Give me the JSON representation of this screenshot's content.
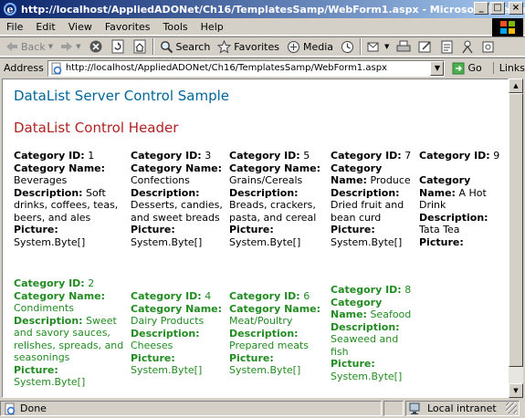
{
  "window": {
    "title": "http://localhost/AppliedADONet/Ch16/TemplatesSamp/WebForm1.aspx - Microsoft Internet Explorer",
    "minimize": "_",
    "maximize": "□",
    "close": "×"
  },
  "menu": [
    "File",
    "Edit",
    "View",
    "Favorites",
    "Tools",
    "Help"
  ],
  "toolbar": {
    "back": "Back",
    "search": "Search",
    "favorites": "Favorites",
    "media": "Media"
  },
  "address": {
    "label": "Address",
    "url": "http://localhost/AppliedADONet/Ch16/TemplatesSamp/WebForm1.aspx",
    "go": "Go",
    "links": "Links"
  },
  "page": {
    "heading": "DataList Server Control Sample",
    "list_header": "DataList Control Header",
    "labels": {
      "id": "Category ID:",
      "name": "Category Name:",
      "desc": "Description:",
      "pic": "Picture:"
    },
    "items": [
      {
        "id": "1",
        "name": "Beverages",
        "desc": "Soft drinks, coffees, teas, beers, and ales",
        "pic": "System.Byte[]",
        "style": "normal"
      },
      {
        "id": "3",
        "name": "Confections",
        "desc": "Desserts, candies, and sweet breads",
        "pic": "System.Byte[]",
        "style": "normal"
      },
      {
        "id": "5",
        "name": "Grains/Cereals",
        "desc": "Breads, crackers, pasta, and cereal",
        "pic": "System.Byte[]",
        "style": "normal"
      },
      {
        "id": "7",
        "name": "Produce",
        "desc": "Dried fruit and bean curd",
        "pic": "System.Byte[]",
        "style": "normal"
      },
      {
        "id": "9",
        "name": "A Hot Drink",
        "desc": "Tata Tea",
        "pic": "",
        "style": "normal"
      },
      {
        "id": "2",
        "name": "Condiments",
        "desc": "Sweet and savory sauces, relishes, spreads, and seasonings",
        "pic": "System.Byte[]",
        "style": "alternate"
      },
      {
        "id": "4",
        "name": "Dairy Products",
        "desc": "Cheeses",
        "pic": "System.Byte[]",
        "style": "alternate"
      },
      {
        "id": "6",
        "name": "Meat/Poultry",
        "desc": "Prepared meats",
        "pic": "System.Byte[]",
        "style": "alternate"
      },
      {
        "id": "8",
        "name": "Seafood",
        "desc": "Seaweed and fish",
        "pic": "System.Byte[]",
        "style": "alternate"
      }
    ]
  },
  "status": {
    "text": "Done",
    "zone": "Local intranet"
  },
  "colors": {
    "heading": "#006699",
    "header": "#b22222",
    "alternate_item": "#228b22"
  }
}
